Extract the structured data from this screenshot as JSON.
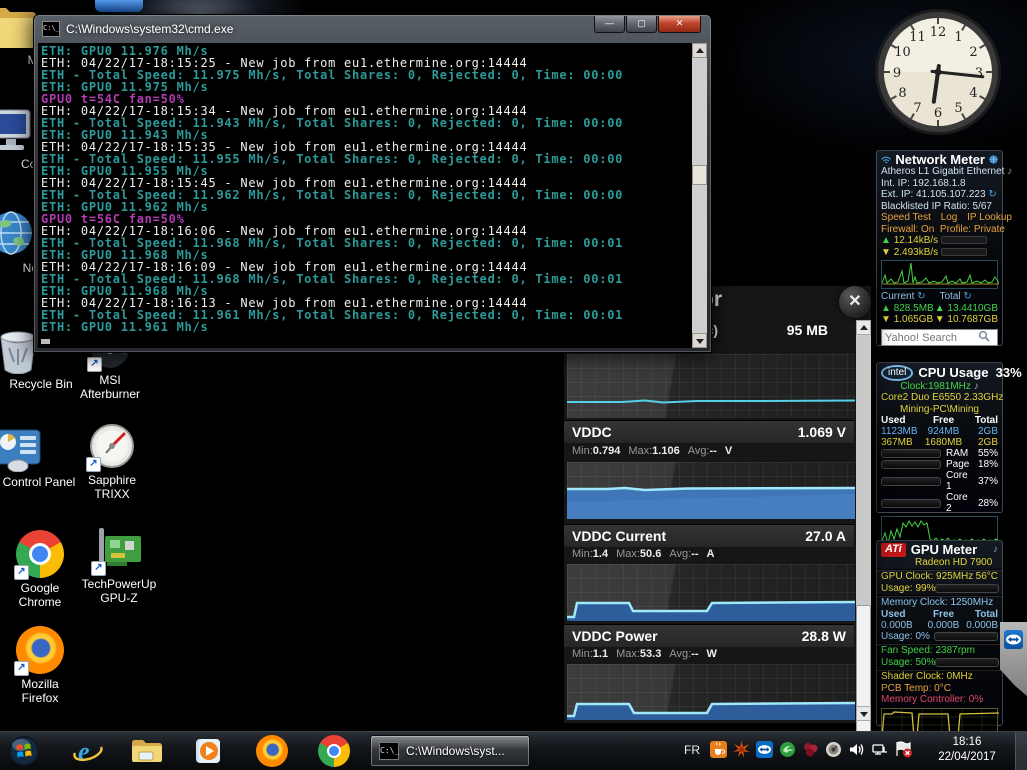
{
  "desktop_icons": [
    {
      "id": "mining-folder",
      "label": "Mi"
    },
    {
      "id": "computer",
      "label": "Con"
    },
    {
      "id": "network-places",
      "label": "Net"
    },
    {
      "id": "recycle-bin",
      "label": "Recycle Bin"
    },
    {
      "id": "msi-afterburner",
      "label": "MSI\nAfterburner"
    },
    {
      "id": "control-panel",
      "label": "Control Panel"
    },
    {
      "id": "sapphire-trixx",
      "label": "Sapphire\nTRIXX"
    },
    {
      "id": "google-chrome",
      "label": "Google\nChrome"
    },
    {
      "id": "techpowerup-gpu-z",
      "label": "TechPowerUp\nGPU-Z"
    },
    {
      "id": "mozilla-firefox",
      "label": "Mozilla\nFirefox"
    }
  ],
  "cmd": {
    "title": "C:\\Windows\\system32\\cmd.exe",
    "lines": [
      {
        "t": "ETH: GPU0 11.976 Mh/s",
        "c": "teal"
      },
      {
        "t": "ETH: 04/22/17-18:15:25 - New job from eu1.ethermine.org:14444",
        "c": "white"
      },
      {
        "t": "ETH - Total Speed: 11.975 Mh/s, Total Shares: 0, Rejected: 0, Time: 00:00",
        "c": "teal"
      },
      {
        "t": "ETH: GPU0 11.975 Mh/s",
        "c": "teal"
      },
      {
        "t": "GPU0 t=54C fan=50%",
        "c": "magenta"
      },
      {
        "t": "ETH: 04/22/17-18:15:34 - New job from eu1.ethermine.org:14444",
        "c": "white"
      },
      {
        "t": "ETH - Total Speed: 11.943 Mh/s, Total Shares: 0, Rejected: 0, Time: 00:00",
        "c": "teal"
      },
      {
        "t": "ETH: GPU0 11.943 Mh/s",
        "c": "teal"
      },
      {
        "t": "ETH: 04/22/17-18:15:35 - New job from eu1.ethermine.org:14444",
        "c": "white"
      },
      {
        "t": "ETH - Total Speed: 11.955 Mh/s, Total Shares: 0, Rejected: 0, Time: 00:00",
        "c": "teal"
      },
      {
        "t": "ETH: GPU0 11.955 Mh/s",
        "c": "teal"
      },
      {
        "t": "ETH: 04/22/17-18:15:45 - New job from eu1.ethermine.org:14444",
        "c": "white"
      },
      {
        "t": "ETH - Total Speed: 11.962 Mh/s, Total Shares: 0, Rejected: 0, Time: 00:00",
        "c": "teal"
      },
      {
        "t": "ETH: GPU0 11.962 Mh/s",
        "c": "teal"
      },
      {
        "t": "GPU0 t=56C fan=50%",
        "c": "magenta"
      },
      {
        "t": "ETH: 04/22/17-18:16:06 - New job from eu1.ethermine.org:14444",
        "c": "white"
      },
      {
        "t": "ETH - Total Speed: 11.968 Mh/s, Total Shares: 0, Rejected: 0, Time: 00:01",
        "c": "teal"
      },
      {
        "t": "ETH: GPU0 11.968 Mh/s",
        "c": "teal"
      },
      {
        "t": "ETH: 04/22/17-18:16:09 - New job from eu1.ethermine.org:14444",
        "c": "white"
      },
      {
        "t": "ETH - Total Speed: 11.968 Mh/s, Total Shares: 0, Rejected: 0, Time: 00:01",
        "c": "teal"
      },
      {
        "t": "ETH: GPU0 11.968 Mh/s",
        "c": "teal"
      },
      {
        "t": "ETH: 04/22/17-18:16:13 - New job from eu1.ethermine.org:14444",
        "c": "white"
      },
      {
        "t": "ETH - Total Speed: 11.961 Mh/s, Total Shares: 0, Rejected: 0, Time: 00:01",
        "c": "teal"
      },
      {
        "t": "ETH: GPU0 11.961 Mh/s",
        "c": "teal"
      }
    ]
  },
  "monitor": {
    "title_visible": "tor",
    "memory": {
      "label_visible": "(ic)",
      "value": "95 MB"
    },
    "sections": [
      {
        "name": "VDDC",
        "value": "1.069 V",
        "min": "0.794",
        "max": "1.106",
        "avg": "--",
        "unit": "V"
      },
      {
        "name": "VDDC Current",
        "value": "27.0 A",
        "min": "1.4",
        "max": "50.6",
        "avg": "--",
        "unit": "A"
      },
      {
        "name": "VDDC Power",
        "value": "28.8 W",
        "min": "1.1",
        "max": "53.3",
        "avg": "--",
        "unit": "W"
      }
    ]
  },
  "gadgets": {
    "clock": {
      "time": "18:16"
    },
    "network": {
      "title": "Network Meter",
      "adapter": "Atheros L1 Gigabit Ethernet",
      "int_ip": "Int. IP: 192.168.1.8",
      "ext_ip": "Ext. IP: 41.105.107.223",
      "blacklist": "Blacklisted IP Ratio: 5/67",
      "links": [
        "Speed Test",
        "Log",
        "IP Lookup"
      ],
      "firewall": "Firewall: On",
      "profile": "Profile: Private",
      "up_speed": "12.14kB/s",
      "down_speed": "2.493kB/s",
      "current_label": "Current",
      "total_label": "Total",
      "up_current": "828.5MB",
      "up_total": "13.4410GB",
      "down_current": "1.065GB",
      "down_total": "10.7687GB",
      "search_placeholder": "Yahoo! Search"
    },
    "cpu": {
      "title": "CPU Usage",
      "usage": "33%",
      "clock": "Clock:1981MHz",
      "cpu_name": "Core2 Duo E6550 2.33GHz",
      "host": "Mining-PC\\Mining",
      "col_used": "Used",
      "col_free": "Free",
      "col_total": "Total",
      "ram_row": [
        "1123MB",
        "924MB",
        "2GB"
      ],
      "page_row": [
        "367MB",
        "1680MB",
        "2GB"
      ],
      "bars": [
        {
          "label": "RAM",
          "pct": "55%"
        },
        {
          "label": "Page",
          "pct": "18%"
        },
        {
          "label": "Core 1",
          "pct": "37%"
        },
        {
          "label": "Core 2",
          "pct": "28%"
        }
      ]
    },
    "gpu": {
      "title": "GPU Meter",
      "gpu_name": "Radeon HD 7900",
      "gpu_clock": "GPU Clock: 925MHz",
      "temp": "56°C",
      "usage_label": "Usage: 99%",
      "mem_clock": "Memory Clock: 1250MHz",
      "col_used": "Used",
      "col_free": "Free",
      "col_total": "Total",
      "mem_row": [
        "0.000B",
        "0.000B",
        "0.000B"
      ],
      "mem_usage_label": "Usage: 0%",
      "fan_speed": "Fan Speed: 2387rpm",
      "fan_usage_label": "Usage: 50%",
      "shader": "Shader Clock: 0MHz",
      "pcb": "PCB Temp: 0°C",
      "mem_ctrl": "Memory Controller: 0%"
    }
  },
  "taskbar": {
    "task_button": "C:\\Windows\\syst...",
    "language": "FR",
    "time": "18:16",
    "date": "22/04/2017",
    "tray_icons": [
      "java",
      "starburst",
      "teamviewer",
      "swirl",
      "berries",
      "dial",
      "volume",
      "network",
      "flag-alert"
    ],
    "quick_launch": [
      "start",
      "internet-explorer",
      "windows-explorer",
      "media-player",
      "firefox",
      "chrome"
    ]
  }
}
